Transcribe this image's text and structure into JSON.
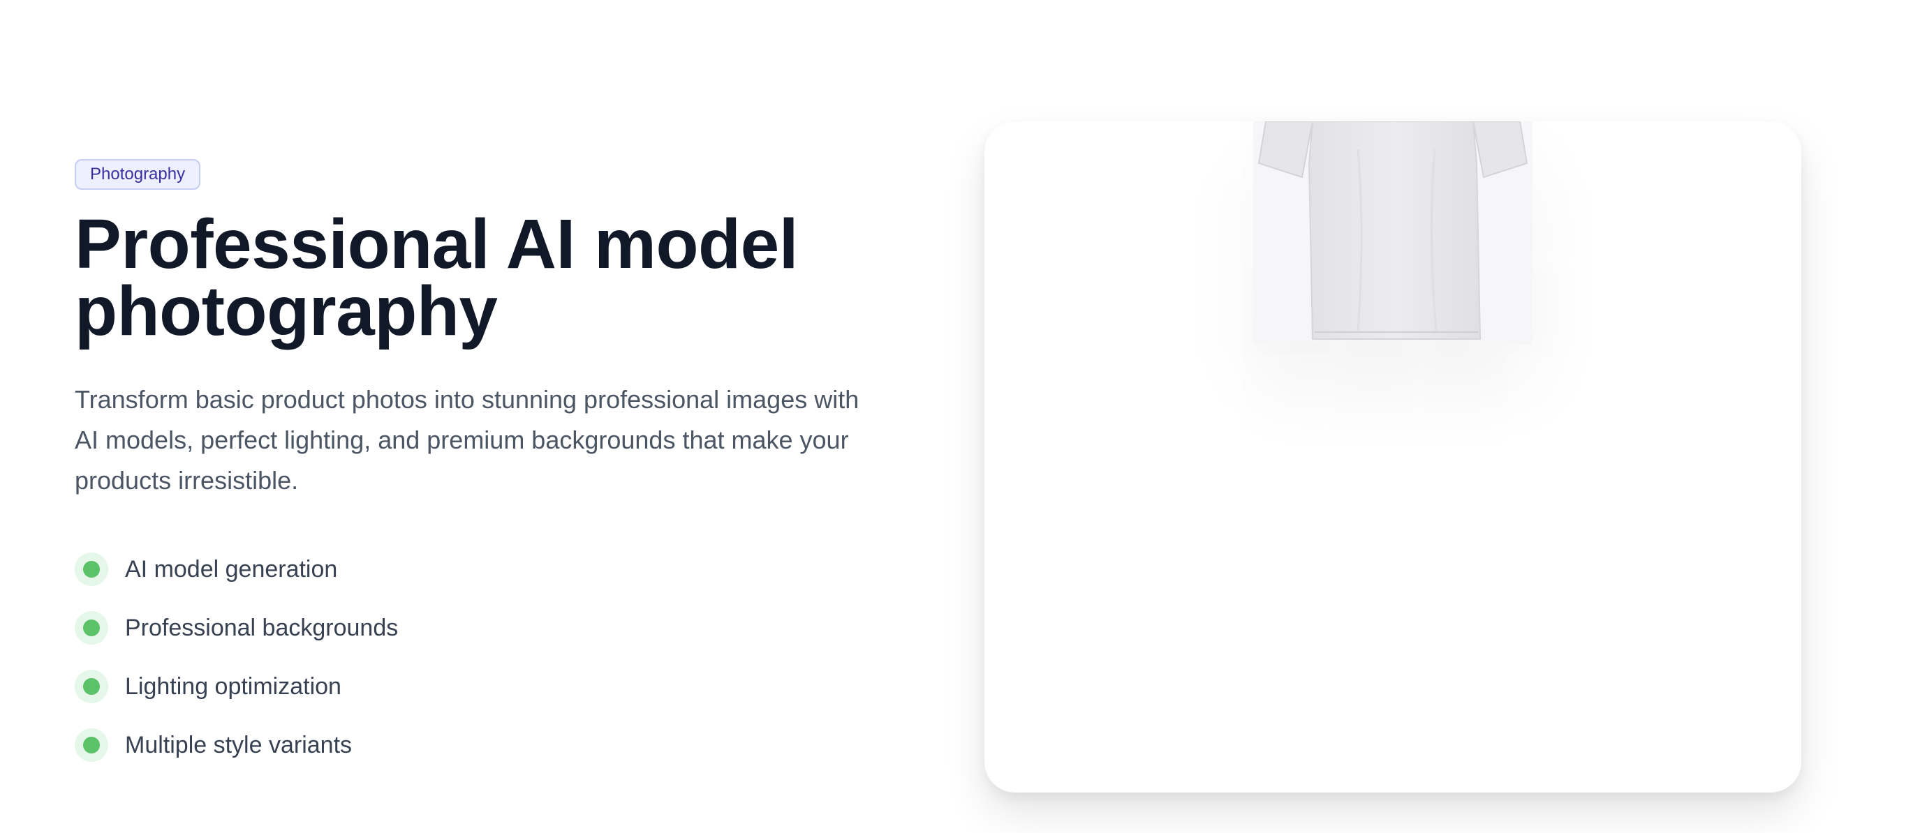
{
  "hero": {
    "badge": "Photography",
    "title_line1": "Professional AI model",
    "title_line2": "photography",
    "description": "Transform basic product photos into stunning professional images with AI models, perfect lighting, and premium backgrounds that make your products irresistible.",
    "features": [
      {
        "label": "AI model generation"
      },
      {
        "label": "Professional backgrounds"
      },
      {
        "label": "Lighting optimization"
      },
      {
        "label": "Multiple style variants"
      }
    ]
  },
  "preview": {
    "image_icon": "tshirt-icon"
  },
  "colors": {
    "title": "#111827",
    "body": "#4b5563",
    "badge_bg": "#eef0ff",
    "badge_text": "#3730a3",
    "feature_dot": "#5cc26a",
    "feature_dot_halo": "#e4f7e8"
  }
}
